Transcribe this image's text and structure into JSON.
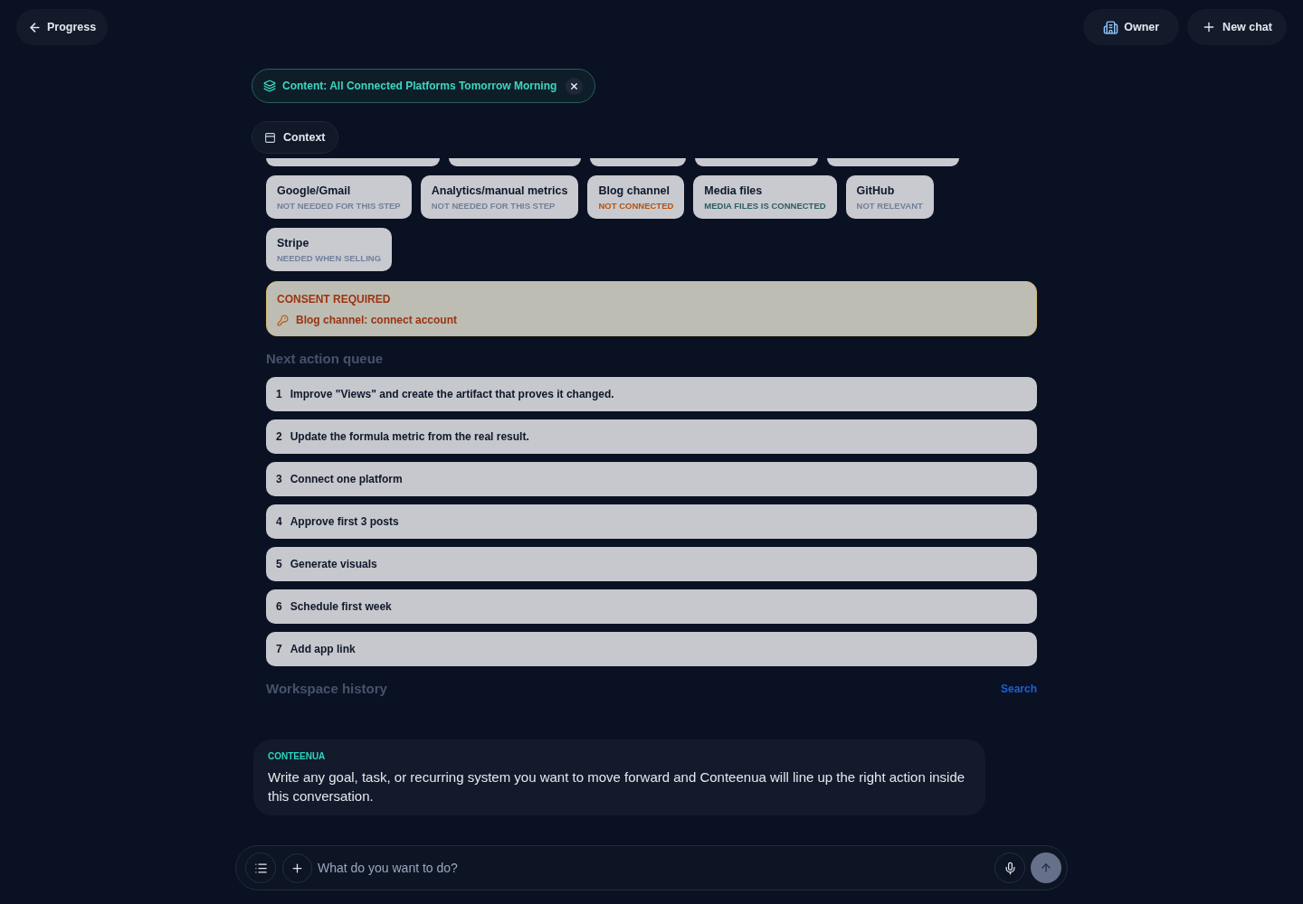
{
  "header": {
    "back_button": "Progress",
    "owner_button": "Owner",
    "new_chat_button": "New chat"
  },
  "topic_chip": {
    "label": "Content: All Connected Platforms Tomorrow Morning"
  },
  "context_button": "Context",
  "platforms": [
    {
      "name": "Google/Gmail",
      "status": "NOT NEEDED FOR THIS STEP",
      "color": "#72809a"
    },
    {
      "name": "Analytics/manual metrics",
      "status": "NOT NEEDED FOR THIS STEP",
      "color": "#72809a"
    },
    {
      "name": "Blog channel",
      "status": "NOT CONNECTED",
      "color": "#b4530d"
    },
    {
      "name": "Media files",
      "status": "MEDIA FILES IS CONNECTED",
      "color": "#2b5d61"
    },
    {
      "name": "GitHub",
      "status": "NOT RELEVANT",
      "color": "#72809a"
    },
    {
      "name": "Stripe",
      "status": "NEEDED WHEN SELLING",
      "color": "#72809a"
    }
  ],
  "consent": {
    "title": "CONSENT REQUIRED",
    "items": [
      "Blog channel: connect account"
    ]
  },
  "queue": {
    "title": "Next action queue",
    "items": [
      {
        "number": "1",
        "text": "Improve \"Views\" and create the artifact that proves it changed."
      },
      {
        "number": "2",
        "text": "Update the formula metric from the real result."
      },
      {
        "number": "3",
        "text": "Connect one platform"
      },
      {
        "number": "4",
        "text": "Approve first 3 posts"
      },
      {
        "number": "5",
        "text": "Generate visuals"
      },
      {
        "number": "6",
        "text": "Schedule first week"
      },
      {
        "number": "7",
        "text": "Add app link"
      }
    ]
  },
  "history": {
    "title": "Workspace history",
    "search_link": "Search"
  },
  "message": {
    "sender": "CONTEENUA",
    "text": "Write any goal, task, or recurring system you want to move forward and Conteenua will line up the right action inside this conversation."
  },
  "composer": {
    "placeholder": "What do you want to do?"
  }
}
